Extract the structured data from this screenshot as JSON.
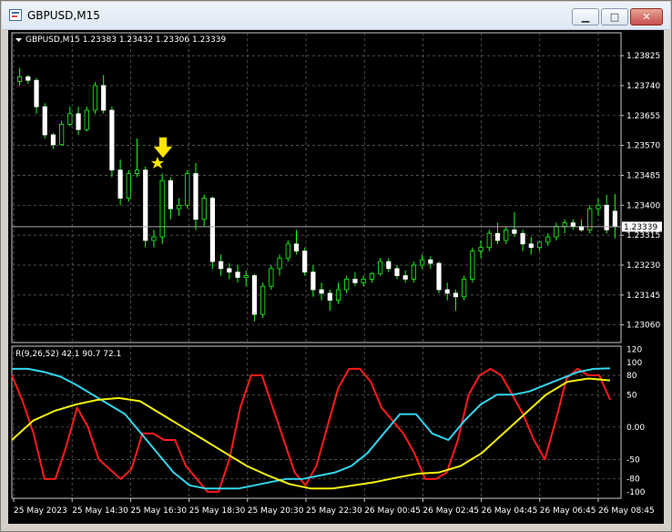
{
  "window": {
    "title": "GBPUSD,M15",
    "buttons": {
      "minimize": "▁",
      "maximize": "□",
      "close": "✕"
    }
  },
  "main_chart": {
    "header": "GBPUSD,M15  1.23383 1.23432 1.23306 1.23339",
    "symbol_timeframe": "GBPUSD,M15",
    "ohlc": {
      "open": "1.23383",
      "high": "1.23432",
      "low": "1.23306",
      "close": "1.23339"
    },
    "current_price_label": "1.23339",
    "price_axis_labels": [
      "1.23825",
      "1.23740",
      "1.23655",
      "1.23570",
      "1.23485",
      "1.23400",
      "1.23315",
      "1.23230",
      "1.23145",
      "1.23060"
    ]
  },
  "indicator": {
    "header": "R(9,26,52) 42.1 90.7 72.1",
    "name": "R(9,26,52)",
    "values": [
      "42.1",
      "90.7",
      "72.1"
    ],
    "axis_labels": [
      "120",
      "100",
      "80",
      "50",
      "0.00",
      "-50",
      "-80",
      "-100"
    ],
    "series_colors": {
      "fast": "#ff1c1c",
      "medium": "#33d6f0",
      "slow": "#f7f20a"
    }
  },
  "time_axis_labels": [
    "25 May 2023",
    "25 May 14:30",
    "25 May 16:30",
    "25 May 18:30",
    "25 May 20:30",
    "25 May 22:30",
    "26 May 00:45",
    "26 May 02:45",
    "26 May 04:45",
    "26 May 06:45",
    "26 May 08:45"
  ],
  "chart_data": [
    {
      "type": "candlestick",
      "title": "GBPUSD,M15",
      "ylim": [
        1.2301,
        1.2389
      ],
      "current_price": 1.23339,
      "candles": [
        [
          1.23752,
          1.2379,
          1.2374,
          1.23765
        ],
        [
          1.23765,
          1.2377,
          1.23745,
          1.23755
        ],
        [
          1.23755,
          1.23762,
          1.2366,
          1.2368
        ],
        [
          1.2368,
          1.2369,
          1.2359,
          1.236
        ],
        [
          1.236,
          1.23605,
          1.2356,
          1.23572
        ],
        [
          1.23572,
          1.2364,
          1.2357,
          1.2363
        ],
        [
          1.2363,
          1.2368,
          1.23625,
          1.2366
        ],
        [
          1.2366,
          1.2368,
          1.236,
          1.23615
        ],
        [
          1.23615,
          1.2368,
          1.2361,
          1.2367
        ],
        [
          1.2367,
          1.2375,
          1.2366,
          1.2374
        ],
        [
          1.2374,
          1.2377,
          1.2366,
          1.2367
        ],
        [
          1.2367,
          1.2368,
          1.2348,
          1.235
        ],
        [
          1.235,
          1.2353,
          1.234,
          1.2342
        ],
        [
          1.2342,
          1.235,
          1.2341,
          1.2349
        ],
        [
          1.2349,
          1.2359,
          1.2348,
          1.235
        ],
        [
          1.235,
          1.2351,
          1.2328,
          1.233
        ],
        [
          1.233,
          1.2333,
          1.2328,
          1.2331
        ],
        [
          1.2331,
          1.2349,
          1.2329,
          1.2347
        ],
        [
          1.2347,
          1.2348,
          1.2336,
          1.2339
        ],
        [
          1.2339,
          1.2342,
          1.2337,
          1.234
        ],
        [
          1.234,
          1.235,
          1.2339,
          1.2349
        ],
        [
          1.2349,
          1.2352,
          1.2333,
          1.2336
        ],
        [
          1.2336,
          1.2343,
          1.2334,
          1.2342
        ],
        [
          1.2342,
          1.23425,
          1.2322,
          1.2324
        ],
        [
          1.2324,
          1.2326,
          1.232,
          1.2322
        ],
        [
          1.2322,
          1.23235,
          1.2319,
          1.2321
        ],
        [
          1.2321,
          1.2323,
          1.2318,
          1.23195
        ],
        [
          1.23195,
          1.23215,
          1.2317,
          1.232
        ],
        [
          1.232,
          1.23205,
          1.2307,
          1.2309
        ],
        [
          1.2309,
          1.2318,
          1.2308,
          1.2317
        ],
        [
          1.2317,
          1.2323,
          1.2316,
          1.2322
        ],
        [
          1.2322,
          1.2326,
          1.232,
          1.2325
        ],
        [
          1.2325,
          1.233,
          1.2324,
          1.2329
        ],
        [
          1.2329,
          1.2333,
          1.2326,
          1.2327
        ],
        [
          1.2327,
          1.2328,
          1.232,
          1.2321
        ],
        [
          1.2321,
          1.2323,
          1.2314,
          1.2316
        ],
        [
          1.2316,
          1.2318,
          1.2313,
          1.2315
        ],
        [
          1.2315,
          1.2316,
          1.231,
          1.2313
        ],
        [
          1.2313,
          1.2318,
          1.2312,
          1.2316
        ],
        [
          1.2316,
          1.232,
          1.2315,
          1.2319
        ],
        [
          1.2319,
          1.2321,
          1.2317,
          1.2318
        ],
        [
          1.2318,
          1.232,
          1.2317,
          1.2319
        ],
        [
          1.2319,
          1.2321,
          1.2318,
          1.23205
        ],
        [
          1.23205,
          1.2325,
          1.232,
          1.2324
        ],
        [
          1.2324,
          1.2325,
          1.2321,
          1.2322
        ],
        [
          1.2322,
          1.2323,
          1.2319,
          1.232
        ],
        [
          1.232,
          1.23215,
          1.2318,
          1.2319
        ],
        [
          1.2319,
          1.2324,
          1.2318,
          1.2323
        ],
        [
          1.2323,
          1.2326,
          1.2322,
          1.23245
        ],
        [
          1.23245,
          1.23255,
          1.2322,
          1.23235
        ],
        [
          1.23235,
          1.2324,
          1.2315,
          1.2316
        ],
        [
          1.2316,
          1.2318,
          1.2313,
          1.2315
        ],
        [
          1.2315,
          1.2316,
          1.231,
          1.2314
        ],
        [
          1.2314,
          1.232,
          1.2313,
          1.2319
        ],
        [
          1.2319,
          1.2328,
          1.2318,
          1.2327
        ],
        [
          1.2327,
          1.233,
          1.2325,
          1.2328
        ],
        [
          1.2328,
          1.2333,
          1.2327,
          1.2332
        ],
        [
          1.2332,
          1.2335,
          1.2329,
          1.233
        ],
        [
          1.233,
          1.2334,
          1.2329,
          1.2333
        ],
        [
          1.2333,
          1.2338,
          1.2331,
          1.2332
        ],
        [
          1.2332,
          1.2333,
          1.2327,
          1.2329
        ],
        [
          1.2329,
          1.2331,
          1.2326,
          1.2328
        ],
        [
          1.2328,
          1.233,
          1.2327,
          1.23295
        ],
        [
          1.23295,
          1.2332,
          1.23285,
          1.2331
        ],
        [
          1.2331,
          1.2335,
          1.233,
          1.2334
        ],
        [
          1.2334,
          1.2336,
          1.2332,
          1.2335
        ],
        [
          1.2335,
          1.2336,
          1.2333,
          1.2334
        ],
        [
          1.2334,
          1.2336,
          1.23325,
          1.2333
        ],
        [
          1.2333,
          1.234,
          1.2332,
          1.2339
        ],
        [
          1.2339,
          1.2342,
          1.2337,
          1.234
        ],
        [
          1.234,
          1.2343,
          1.2332,
          1.2333
        ],
        [
          1.23383,
          1.23432,
          1.23306,
          1.23339
        ]
      ]
    },
    {
      "type": "line",
      "title": "R(9,26,52)",
      "ylim": [
        -110,
        125
      ],
      "series": [
        {
          "name": "9",
          "values": [
            80,
            40,
            -10,
            -80,
            -80,
            -30,
            30,
            0,
            -50,
            -65,
            -80,
            -65,
            -10,
            -10,
            -20,
            -20,
            -60,
            -80,
            -100,
            -100,
            -50,
            30,
            80,
            80,
            30,
            -20,
            -70,
            -90,
            -60,
            0,
            60,
            90,
            90,
            70,
            30,
            10,
            -10,
            -40,
            -80,
            -80,
            -70,
            -20,
            50,
            80,
            90,
            80,
            50,
            20,
            -20,
            -50,
            10,
            75,
            90,
            80,
            80,
            42.1
          ]
        },
        {
          "name": "26",
          "values": [
            90,
            90,
            85,
            78,
            65,
            50,
            35,
            20,
            -10,
            -40,
            -70,
            -90,
            -95,
            -95,
            -95,
            -90,
            -85,
            -80,
            -80,
            -75,
            -70,
            -60,
            -40,
            -10,
            20,
            20,
            -10,
            -20,
            10,
            35,
            50,
            50,
            55,
            65,
            75,
            85,
            90,
            90.7
          ]
        },
        {
          "name": "52",
          "values": [
            -20,
            10,
            25,
            35,
            42,
            45,
            40,
            20,
            0,
            -20,
            -40,
            -60,
            -75,
            -88,
            -95,
            -95,
            -90,
            -85,
            -78,
            -72,
            -70,
            -60,
            -40,
            -10,
            20,
            50,
            70,
            75,
            72.1
          ]
        }
      ]
    }
  ]
}
